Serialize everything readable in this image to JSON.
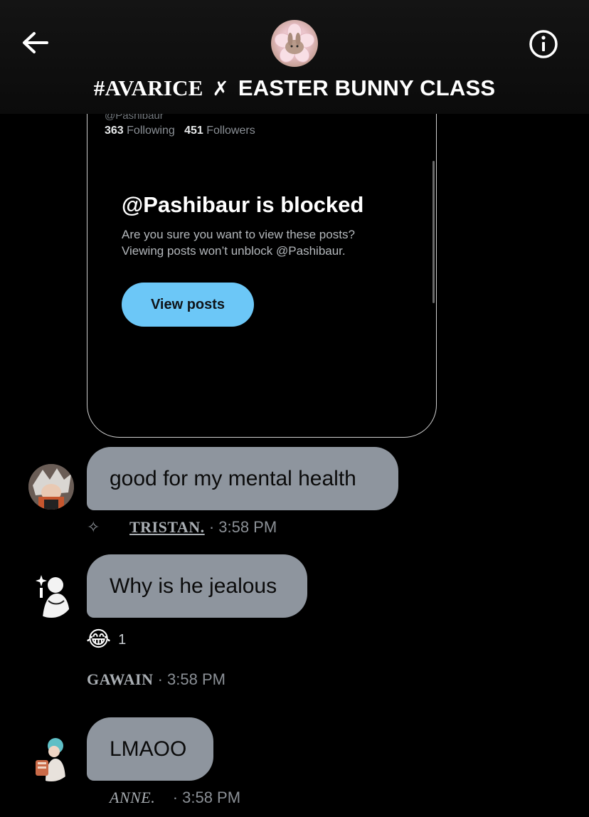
{
  "header": {
    "title_part1": "#AVARICE",
    "title_cross": "✗",
    "title_part2": "EASTER BUNNY CLASS",
    "back_icon": "arrow-left-icon",
    "info_icon": "info-circle-icon"
  },
  "shared_card": {
    "handle": "@Pashibaur",
    "following_count": "363",
    "following_label": "Following",
    "followers_count": "451",
    "followers_label": "Followers",
    "blocked_title": "@Pashibaur is blocked",
    "blocked_line1": "Are you sure you want to view these posts?",
    "blocked_line2": "Viewing posts won’t unblock @Pashibaur.",
    "view_button": "View posts"
  },
  "messages": [
    {
      "text": "good for my mental health",
      "sender": "TRISTAN.",
      "time": "· 3:58 PM",
      "prefix_icon": "sparkle-icon"
    },
    {
      "text": "Why is he jealous",
      "sender": "GAWAIN",
      "time": "· 3:58 PM",
      "reaction_emoji": "😂",
      "reaction_count": "1"
    },
    {
      "text": "LMAOO",
      "sender": "ANNE.",
      "time": "· 3:58 PM"
    }
  ],
  "colors": {
    "background": "#000000",
    "bubble": "#8e959e",
    "button": "#6cc7f7",
    "meta_text": "#8b9096"
  }
}
